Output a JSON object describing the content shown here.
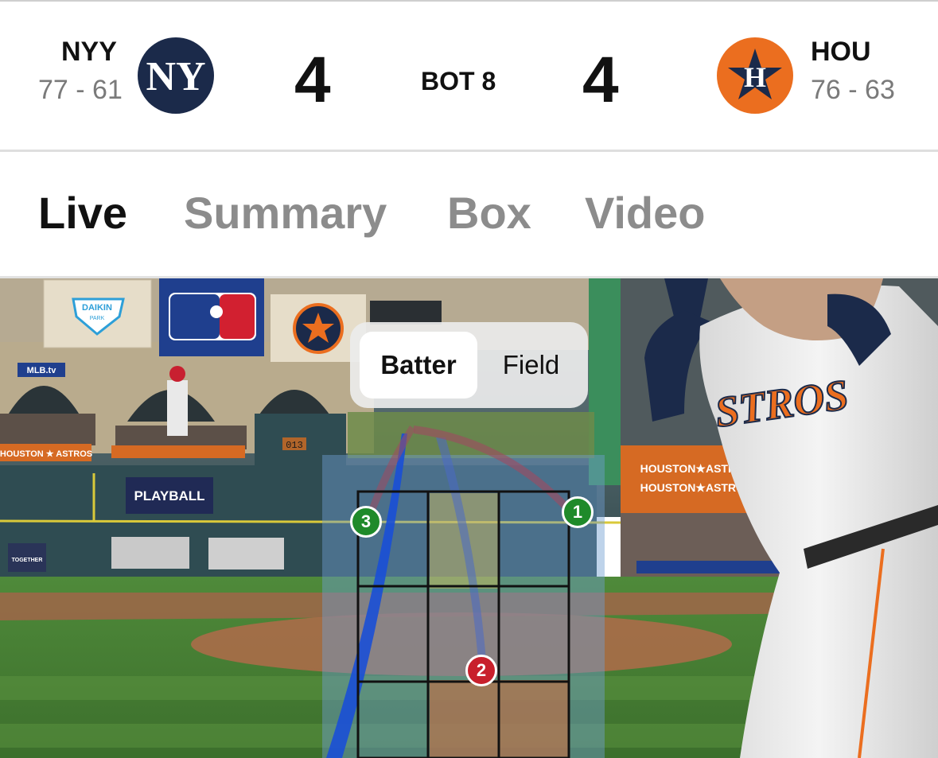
{
  "scoreboard": {
    "away": {
      "abbr": "NYY",
      "record": "77 - 61",
      "score": "4",
      "logo_icon": "yankees-logo",
      "color": "#1b2a4a"
    },
    "home": {
      "abbr": "HOU",
      "record": "76 - 63",
      "score": "4",
      "logo_icon": "astros-logo",
      "color": "#eb6e1f"
    },
    "inning": "BOT 8"
  },
  "tabs": [
    {
      "label": "Live",
      "active": true
    },
    {
      "label": "Summary",
      "active": false
    },
    {
      "label": "Box",
      "active": false
    },
    {
      "label": "Video",
      "active": false
    }
  ],
  "view_toggle": {
    "options": [
      "Batter",
      "Field"
    ],
    "selected": "Batter"
  },
  "pitches": [
    {
      "number": "1",
      "result": "ball",
      "color": "#1f8a2a"
    },
    {
      "number": "2",
      "result": "strike",
      "color": "#c8202c"
    },
    {
      "number": "3",
      "result": "ball",
      "color": "#1f8a2a"
    }
  ],
  "stadium_signage": {
    "sponsor": "DAIKIN",
    "sponsor_sub": "PARK",
    "tv": "MLB.tv",
    "playball": "PLAYBALL",
    "banner": "HOUSTON ★ ASTROS",
    "together": "TOGETHER",
    "scoreboard_text": "013",
    "jersey": "STROS"
  }
}
